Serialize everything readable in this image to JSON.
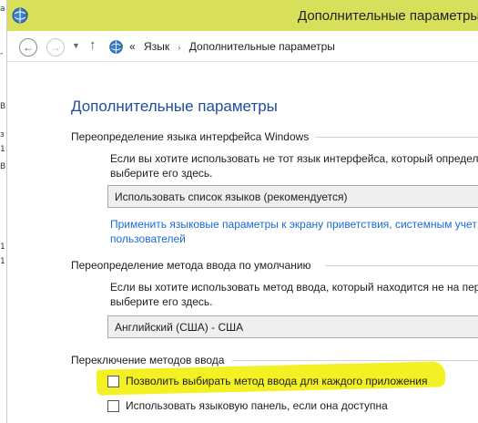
{
  "window": {
    "title": "Дополнительные параметры"
  },
  "left_strip": [
    "а",
    "-",
    "В",
    "з",
    "1",
    "В",
    "1",
    "1"
  ],
  "address_bar": {
    "back_glyph": "←",
    "forward_glyph": "→",
    "dropdown_glyph": "▼",
    "up_glyph": "↑",
    "crumb_prefix": "«",
    "breadcrumbs": [
      "Язык",
      "Дополнительные параметры"
    ],
    "separator": "›"
  },
  "main": {
    "page_title": "Дополнительные параметры",
    "sections": [
      {
        "heading": "Переопределение языка интерфейса Windows",
        "description_lines": [
          "Если вы хотите использовать не тот язык интерфейса, который определе",
          "выберите его здесь."
        ],
        "select_value": "Использовать список языков (рекомендуется)",
        "link_lines": [
          "Применить языковые параметры к экрану приветствия, системным учет",
          "пользователей"
        ]
      },
      {
        "heading": "Переопределение метода ввода по умолчанию",
        "description_lines": [
          "Если вы хотите использовать метод ввода, который находится не на перв",
          "выберите его здесь."
        ],
        "select_value": "Английский (США) - США"
      },
      {
        "heading": "Переключение методов ввода",
        "checkboxes": [
          {
            "label": "Позволить выбирать метод ввода для каждого приложения",
            "checked": false
          },
          {
            "label": "Использовать языковую панель, если она доступна",
            "checked": false
          }
        ]
      }
    ]
  },
  "colors": {
    "titlebar": "#d8e05b",
    "title_blue": "#1e4e9c",
    "link_blue": "#1a6bd0",
    "highlight_marker": "#f2ef18"
  },
  "icons": {
    "app": "language-globe-icon",
    "crumb": "language-globe-icon"
  }
}
